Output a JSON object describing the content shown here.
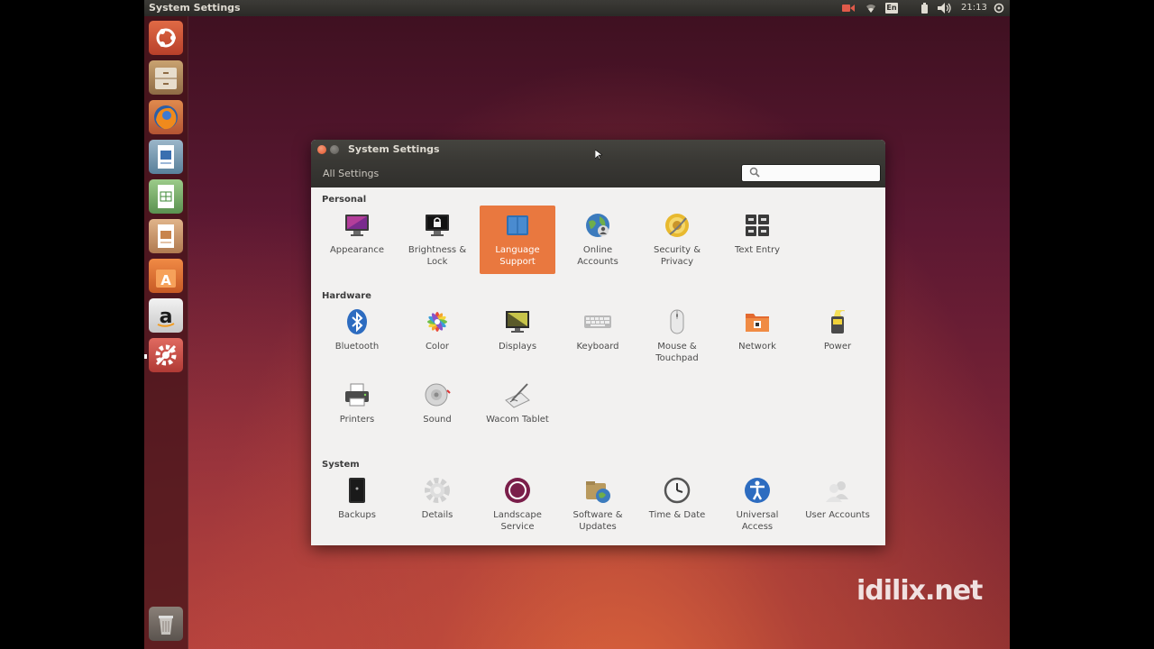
{
  "top_panel": {
    "app_title": "System Settings",
    "keyboard_layout": "En",
    "clock": "21:13"
  },
  "launcher": {
    "items": [
      {
        "name": "Dash"
      },
      {
        "name": "Files"
      },
      {
        "name": "Firefox Web Browser"
      },
      {
        "name": "LibreOffice Writer"
      },
      {
        "name": "LibreOffice Calc"
      },
      {
        "name": "LibreOffice Impress"
      },
      {
        "name": "Ubuntu Software Center"
      },
      {
        "name": "Amazon"
      },
      {
        "name": "System Settings"
      },
      {
        "name": "Trash"
      }
    ]
  },
  "window": {
    "title": "System Settings",
    "toolbar": {
      "all_settings_label": "All Settings",
      "search_placeholder": ""
    },
    "sections": {
      "personal": {
        "title": "Personal",
        "items": [
          {
            "label": "Appearance"
          },
          {
            "label": "Brightness &\nLock"
          },
          {
            "label": "Language\nSupport",
            "selected": true
          },
          {
            "label": "Online\nAccounts"
          },
          {
            "label": "Security &\nPrivacy"
          },
          {
            "label": "Text Entry"
          }
        ]
      },
      "hardware": {
        "title": "Hardware",
        "items": [
          {
            "label": "Bluetooth"
          },
          {
            "label": "Color"
          },
          {
            "label": "Displays"
          },
          {
            "label": "Keyboard"
          },
          {
            "label": "Mouse &\nTouchpad"
          },
          {
            "label": "Network"
          },
          {
            "label": "Power"
          },
          {
            "label": "Printers"
          },
          {
            "label": "Sound"
          },
          {
            "label": "Wacom Tablet"
          }
        ]
      },
      "system": {
        "title": "System",
        "items": [
          {
            "label": "Backups"
          },
          {
            "label": "Details"
          },
          {
            "label": "Landscape\nService"
          },
          {
            "label": "Software &\nUpdates"
          },
          {
            "label": "Time & Date"
          },
          {
            "label": "Universal\nAccess"
          },
          {
            "label": "User Accounts"
          }
        ]
      }
    }
  },
  "watermark": "idilix.net",
  "colors": {
    "selection": "#e9783f",
    "panel": "#2b2a27",
    "accent": "#dd4814"
  }
}
